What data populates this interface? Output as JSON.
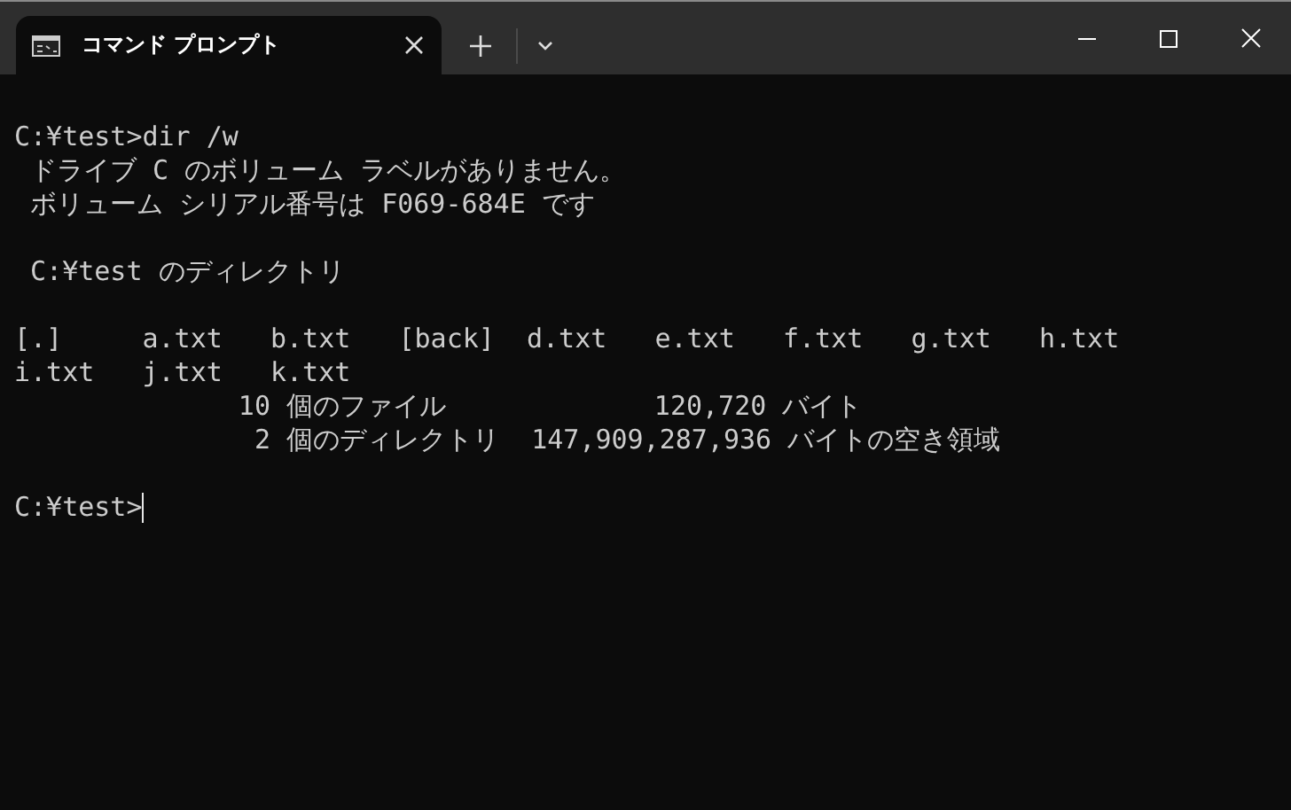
{
  "tab": {
    "title": "コマンド プロンプト",
    "selected": true
  },
  "output_blocks": [
    [
      "C:¥test>dir /w",
      " ドライブ C のボリューム ラベルがありません。",
      " ボリューム シリアル番号は F069-684E です"
    ],
    [
      " C:¥test のディレクトリ"
    ],
    [
      "[.]     a.txt   b.txt   [back]  d.txt   e.txt   f.txt   g.txt   h.txt",
      "i.txt   j.txt   k.txt",
      "              10 個のファイル             120,720 バイト",
      "               2 個のディレクトリ  147,909,287,936 バイトの空き領域"
    ]
  ],
  "prompt": {
    "text": "C:¥test>",
    "cursor": true
  }
}
